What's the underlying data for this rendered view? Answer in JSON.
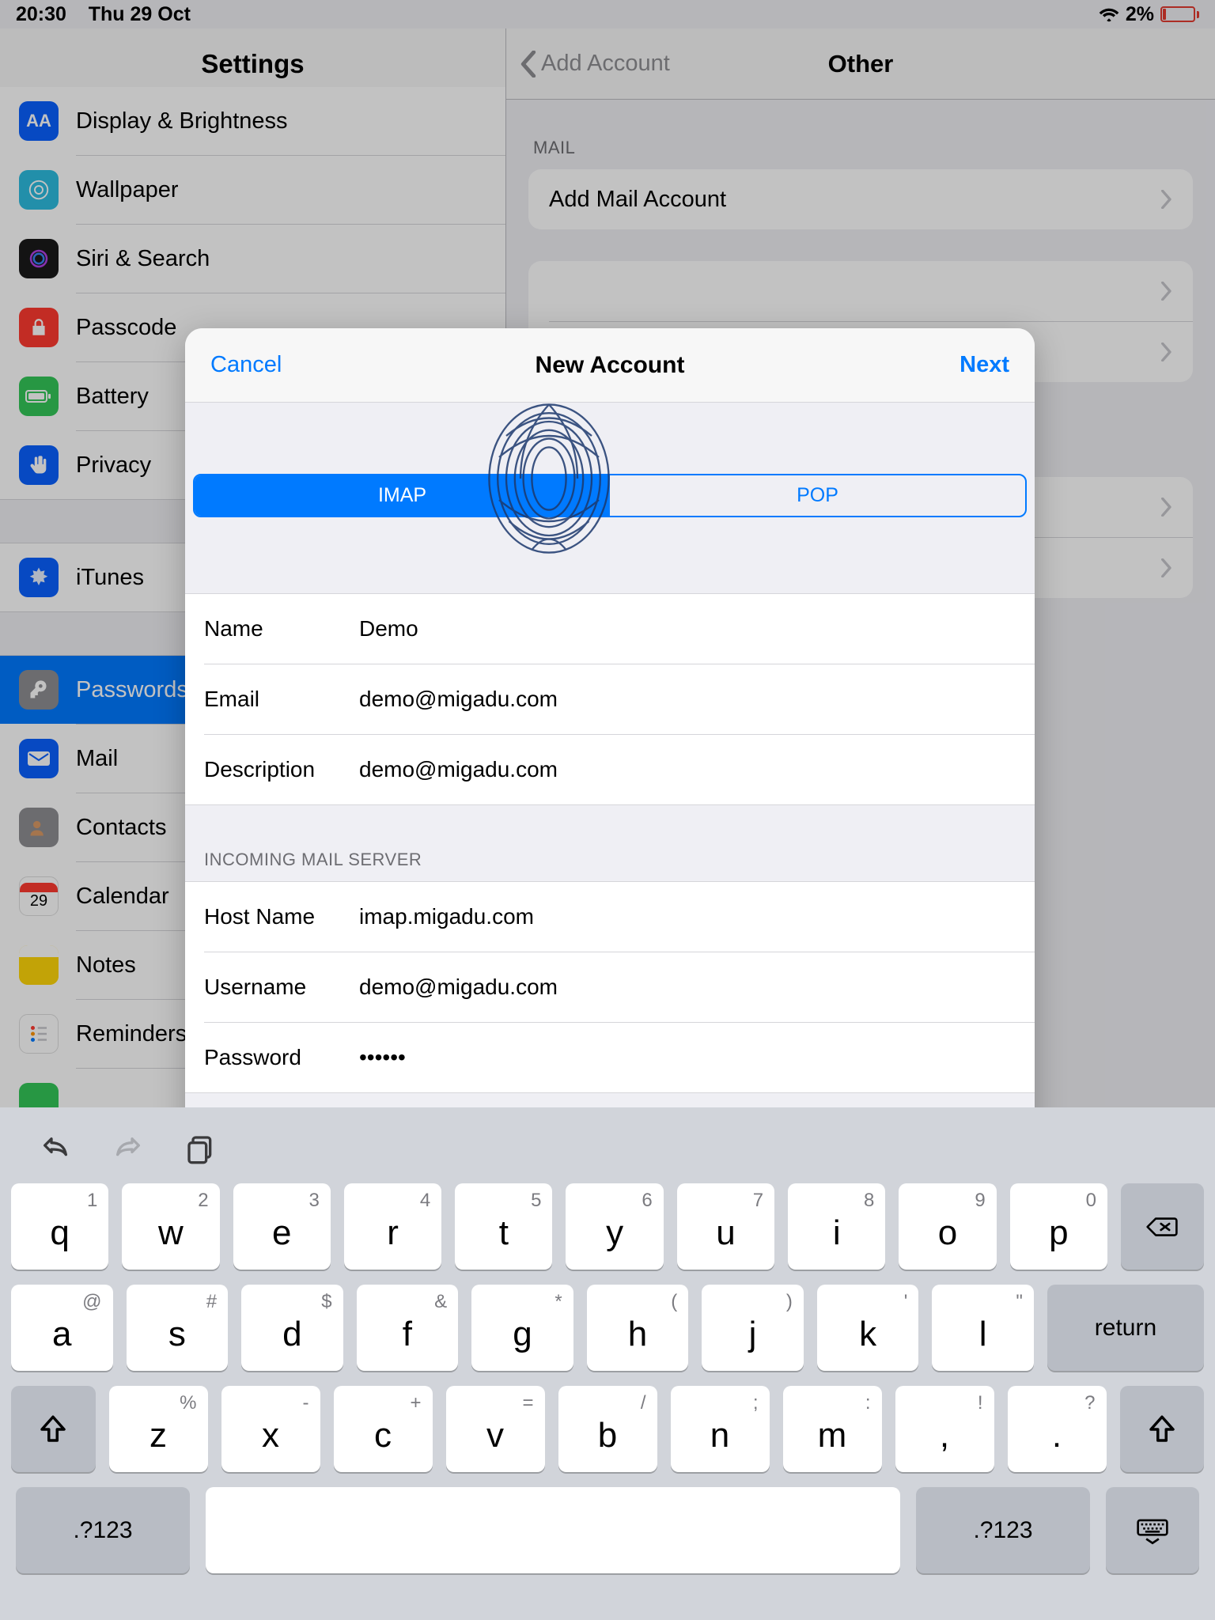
{
  "status": {
    "time": "20:30",
    "date": "Thu 29 Oct",
    "battery_pct": "2%"
  },
  "left": {
    "title": "Settings",
    "items": [
      {
        "label": "Display & Brightness"
      },
      {
        "label": "Wallpaper"
      },
      {
        "label": "Siri & Search"
      },
      {
        "label": "Passcode"
      },
      {
        "label": "Battery"
      },
      {
        "label": "Privacy"
      }
    ],
    "itunes": {
      "label": "iTunes"
    },
    "pw_group": [
      {
        "label": "Passwords"
      },
      {
        "label": "Mail"
      },
      {
        "label": "Contacts"
      },
      {
        "label": "Calendar"
      },
      {
        "label": "Notes"
      },
      {
        "label": "Reminders"
      }
    ]
  },
  "right": {
    "back": "Add Account",
    "title": "Other",
    "section_mail": "MAIL",
    "add_mail": "Add Mail Account"
  },
  "modal": {
    "cancel": "Cancel",
    "title": "New Account",
    "next": "Next",
    "tabs": {
      "imap": "IMAP",
      "pop": "POP"
    },
    "fields": {
      "name_label": "Name",
      "name_value": "Demo",
      "email_label": "Email",
      "email_value": "demo@migadu.com",
      "desc_label": "Description",
      "desc_value": "demo@migadu.com"
    },
    "incoming_header": "INCOMING MAIL SERVER",
    "incoming": {
      "host_label": "Host Name",
      "host_value": "imap.migadu.com",
      "user_label": "Username",
      "user_value": "demo@migadu.com",
      "pass_label": "Password",
      "pass_value": "••••••"
    }
  },
  "keyboard": {
    "row1": [
      {
        "m": "q",
        "s": "1"
      },
      {
        "m": "w",
        "s": "2"
      },
      {
        "m": "e",
        "s": "3"
      },
      {
        "m": "r",
        "s": "4"
      },
      {
        "m": "t",
        "s": "5"
      },
      {
        "m": "y",
        "s": "6"
      },
      {
        "m": "u",
        "s": "7"
      },
      {
        "m": "i",
        "s": "8"
      },
      {
        "m": "o",
        "s": "9"
      },
      {
        "m": "p",
        "s": "0"
      }
    ],
    "row2": [
      {
        "m": "a",
        "s": "@"
      },
      {
        "m": "s",
        "s": "#"
      },
      {
        "m": "d",
        "s": "$"
      },
      {
        "m": "f",
        "s": "&"
      },
      {
        "m": "g",
        "s": "*"
      },
      {
        "m": "h",
        "s": "("
      },
      {
        "m": "j",
        "s": ")"
      },
      {
        "m": "k",
        "s": "'"
      },
      {
        "m": "l",
        "s": "\""
      }
    ],
    "row3": [
      {
        "m": "z",
        "s": "%"
      },
      {
        "m": "x",
        "s": "-"
      },
      {
        "m": "c",
        "s": "+"
      },
      {
        "m": "v",
        "s": "="
      },
      {
        "m": "b",
        "s": "/"
      },
      {
        "m": "n",
        "s": ";"
      },
      {
        "m": "m",
        "s": ":"
      },
      {
        "m": ",",
        "s": "!"
      },
      {
        "m": ".",
        "s": "?"
      }
    ],
    "return": "return",
    "numkey": ".?123"
  }
}
